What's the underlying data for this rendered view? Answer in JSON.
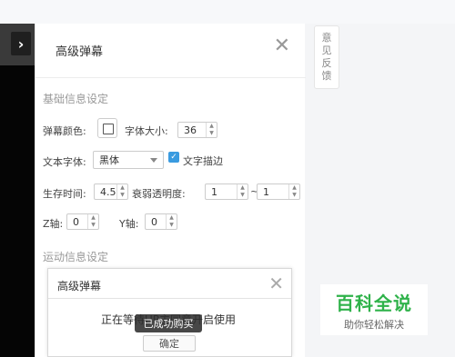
{
  "panel": {
    "title": "高级弹幕",
    "close_icon": "close-icon",
    "basic_section": "基础信息设定",
    "motion_section": "运动信息设定",
    "color_label": "弹幕颜色:",
    "font_size_label": "字体大小:",
    "font_size_value": "36",
    "font_family_label": "文本字体:",
    "font_family_value": "黑体",
    "stroke_label": "文字描边",
    "stroke_checked": true,
    "lifetime_label": "生存时间:",
    "lifetime_value": "4.5",
    "fade_label": "衰弱透明度:",
    "fade_from": "1",
    "fade_sep": "~",
    "fade_to": "1",
    "z_label": "Z轴:",
    "z_value": "0",
    "y_label": "Y轴:",
    "y_value": "0"
  },
  "feedback": {
    "chars": [
      "意",
      "见",
      "反",
      "馈"
    ]
  },
  "dialog": {
    "title": "高级弹幕",
    "message": "正在等待UP主同意开启使用",
    "ok_label": "确定",
    "toast": "已成功购买"
  },
  "brand": {
    "main": "百科全说",
    "sub": "助你轻松解决",
    "color": "#2fb24a"
  }
}
